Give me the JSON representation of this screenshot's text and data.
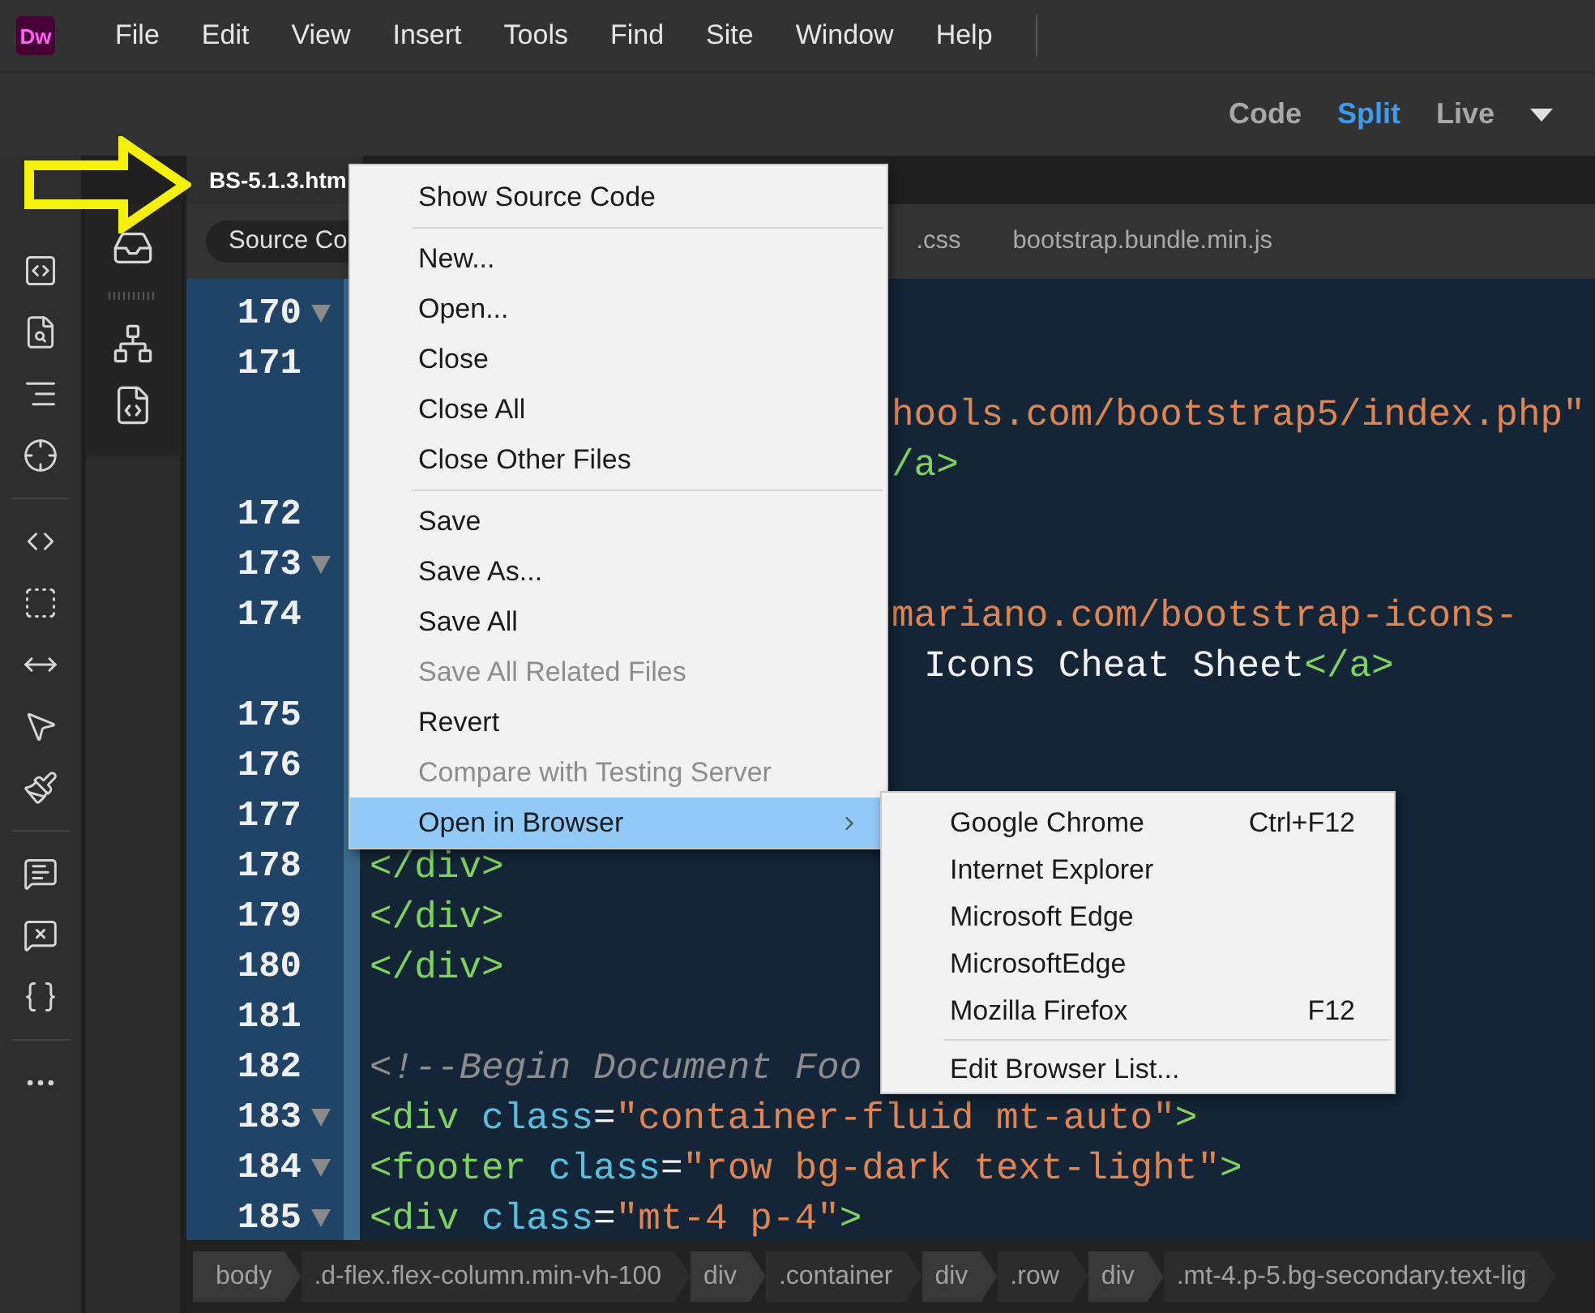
{
  "app_logo": "Dw",
  "menu_bar": [
    "File",
    "Edit",
    "View",
    "Insert",
    "Tools",
    "Find",
    "Site",
    "Window",
    "Help"
  ],
  "view_switch": [
    {
      "label": "Code",
      "selected": false
    },
    {
      "label": "Split",
      "selected": true
    },
    {
      "label": "Live",
      "selected": false
    }
  ],
  "document_tab": {
    "label": "BS-5.1.3.htm"
  },
  "related_files": [
    {
      "label": "Source Co",
      "selected": true
    },
    {
      "label": ".css",
      "selected": false
    },
    {
      "label": "bootstrap.bundle.min.js",
      "selected": false
    }
  ],
  "code_lines": [
    {
      "number": "170",
      "fold": true,
      "kind": "full"
    },
    {
      "number": "171",
      "fold": false,
      "kind": "full"
    },
    {
      "kind": "clipped",
      "fold": false,
      "tokens": [
        {
          "kind": "string",
          "text": "hools.com/bootstrap5/index.php\""
        }
      ]
    },
    {
      "kind": "clipped",
      "fold": false,
      "tokens": [
        {
          "kind": "tag",
          "text": "/a>"
        }
      ]
    },
    {
      "number": "172",
      "fold": false,
      "kind": "full"
    },
    {
      "number": "173",
      "fold": true,
      "kind": "full"
    },
    {
      "number": "174",
      "fold": false,
      "kind": "clipped",
      "tokens": [
        {
          "kind": "string",
          "text": "mariano.com/bootstrap-icons-"
        }
      ]
    },
    {
      "kind": "clipped_word",
      "fold": false,
      "tokens": [
        {
          "kind": "text",
          "text": "Icons Cheat Sheet"
        },
        {
          "kind": "tag",
          "text": "</a>"
        }
      ]
    },
    {
      "number": "175",
      "fold": false,
      "kind": "full"
    },
    {
      "number": "176",
      "fold": false,
      "kind": "full"
    },
    {
      "number": "177",
      "fold": false,
      "kind": "full"
    },
    {
      "number": "178",
      "fold": false,
      "kind": "full",
      "tokens": [
        {
          "kind": "tag",
          "text": "</div>"
        }
      ]
    },
    {
      "number": "179",
      "fold": false,
      "kind": "full",
      "tokens": [
        {
          "kind": "tag",
          "text": "</div>"
        }
      ]
    },
    {
      "number": "180",
      "fold": false,
      "kind": "full",
      "tokens": [
        {
          "kind": "tag",
          "text": "</div>"
        }
      ]
    },
    {
      "number": "181",
      "fold": false,
      "kind": "full"
    },
    {
      "number": "182",
      "fold": false,
      "kind": "full",
      "tokens": [
        {
          "kind": "comment",
          "text": "<!--Begin Document Foo"
        }
      ]
    },
    {
      "number": "183",
      "fold": true,
      "kind": "full",
      "tokens": [
        {
          "kind": "tag",
          "text": "<div"
        },
        {
          "kind": "attr",
          "text": "class"
        },
        {
          "kind": "text",
          "text": "="
        },
        {
          "kind": "string",
          "text": "\"container-fluid mt-auto\""
        },
        {
          "kind": "tag",
          "text": ">"
        }
      ]
    },
    {
      "number": "184",
      "fold": true,
      "kind": "full",
      "tokens": [
        {
          "kind": "tag",
          "text": "<footer"
        },
        {
          "kind": "attr",
          "text": "class"
        },
        {
          "kind": "text",
          "text": "="
        },
        {
          "kind": "string",
          "text": "\"row bg-dark text-light\""
        },
        {
          "kind": "tag",
          "text": ">"
        }
      ]
    },
    {
      "number": "185",
      "fold": true,
      "kind": "full",
      "tokens": [
        {
          "kind": "tag",
          "text": "<div"
        },
        {
          "kind": "attr",
          "text": "class"
        },
        {
          "kind": "text",
          "text": "="
        },
        {
          "kind": "string",
          "text": "\"mt-4 p-4\""
        },
        {
          "kind": "tag",
          "text": ">"
        }
      ]
    }
  ],
  "breadcrumbs": [
    {
      "kind": "tag",
      "label": "body"
    },
    {
      "kind": "class",
      "label": ".d-flex.flex-column.min-vh-100"
    },
    {
      "kind": "tag",
      "label": "div"
    },
    {
      "kind": "class",
      "label": ".container"
    },
    {
      "kind": "tag",
      "label": "div"
    },
    {
      "kind": "class",
      "label": ".row"
    },
    {
      "kind": "tag",
      "label": "div"
    },
    {
      "kind": "class",
      "label": ".mt-4.p-5.bg-secondary.text-lig"
    }
  ],
  "context_menu": [
    {
      "kind": "item",
      "label": "Show Source Code",
      "disabled": false,
      "selected": false,
      "submenu": false
    },
    {
      "kind": "separator"
    },
    {
      "kind": "item",
      "label": "New...",
      "disabled": false,
      "selected": false,
      "submenu": false
    },
    {
      "kind": "item",
      "label": "Open...",
      "disabled": false,
      "selected": false,
      "submenu": false
    },
    {
      "kind": "item",
      "label": "Close",
      "disabled": false,
      "selected": false,
      "submenu": false
    },
    {
      "kind": "item",
      "label": "Close All",
      "disabled": false,
      "selected": false,
      "submenu": false
    },
    {
      "kind": "item",
      "label": "Close Other Files",
      "disabled": false,
      "selected": false,
      "submenu": false
    },
    {
      "kind": "separator"
    },
    {
      "kind": "item",
      "label": "Save",
      "disabled": false,
      "selected": false,
      "submenu": false
    },
    {
      "kind": "item",
      "label": "Save As...",
      "disabled": false,
      "selected": false,
      "submenu": false
    },
    {
      "kind": "item",
      "label": "Save All",
      "disabled": false,
      "selected": false,
      "submenu": false
    },
    {
      "kind": "item",
      "label": "Save All Related Files",
      "disabled": true,
      "selected": false,
      "submenu": false
    },
    {
      "kind": "item",
      "label": "Revert",
      "disabled": false,
      "selected": false,
      "submenu": false
    },
    {
      "kind": "item",
      "label": "Compare with Testing Server",
      "disabled": true,
      "selected": false,
      "submenu": false
    },
    {
      "kind": "item",
      "label": "Open in Browser",
      "disabled": false,
      "selected": true,
      "submenu": true
    }
  ],
  "browser_submenu": [
    {
      "kind": "item",
      "label": "Google Chrome",
      "shortcut": "Ctrl+F12"
    },
    {
      "kind": "item",
      "label": "Internet Explorer"
    },
    {
      "kind": "item",
      "label": "Microsoft Edge"
    },
    {
      "kind": "item",
      "label": "MicrosoftEdge"
    },
    {
      "kind": "item",
      "label": "Mozilla Firefox",
      "shortcut": "F12"
    },
    {
      "kind": "separator"
    },
    {
      "kind": "item",
      "label": "Edit Browser List..."
    }
  ]
}
